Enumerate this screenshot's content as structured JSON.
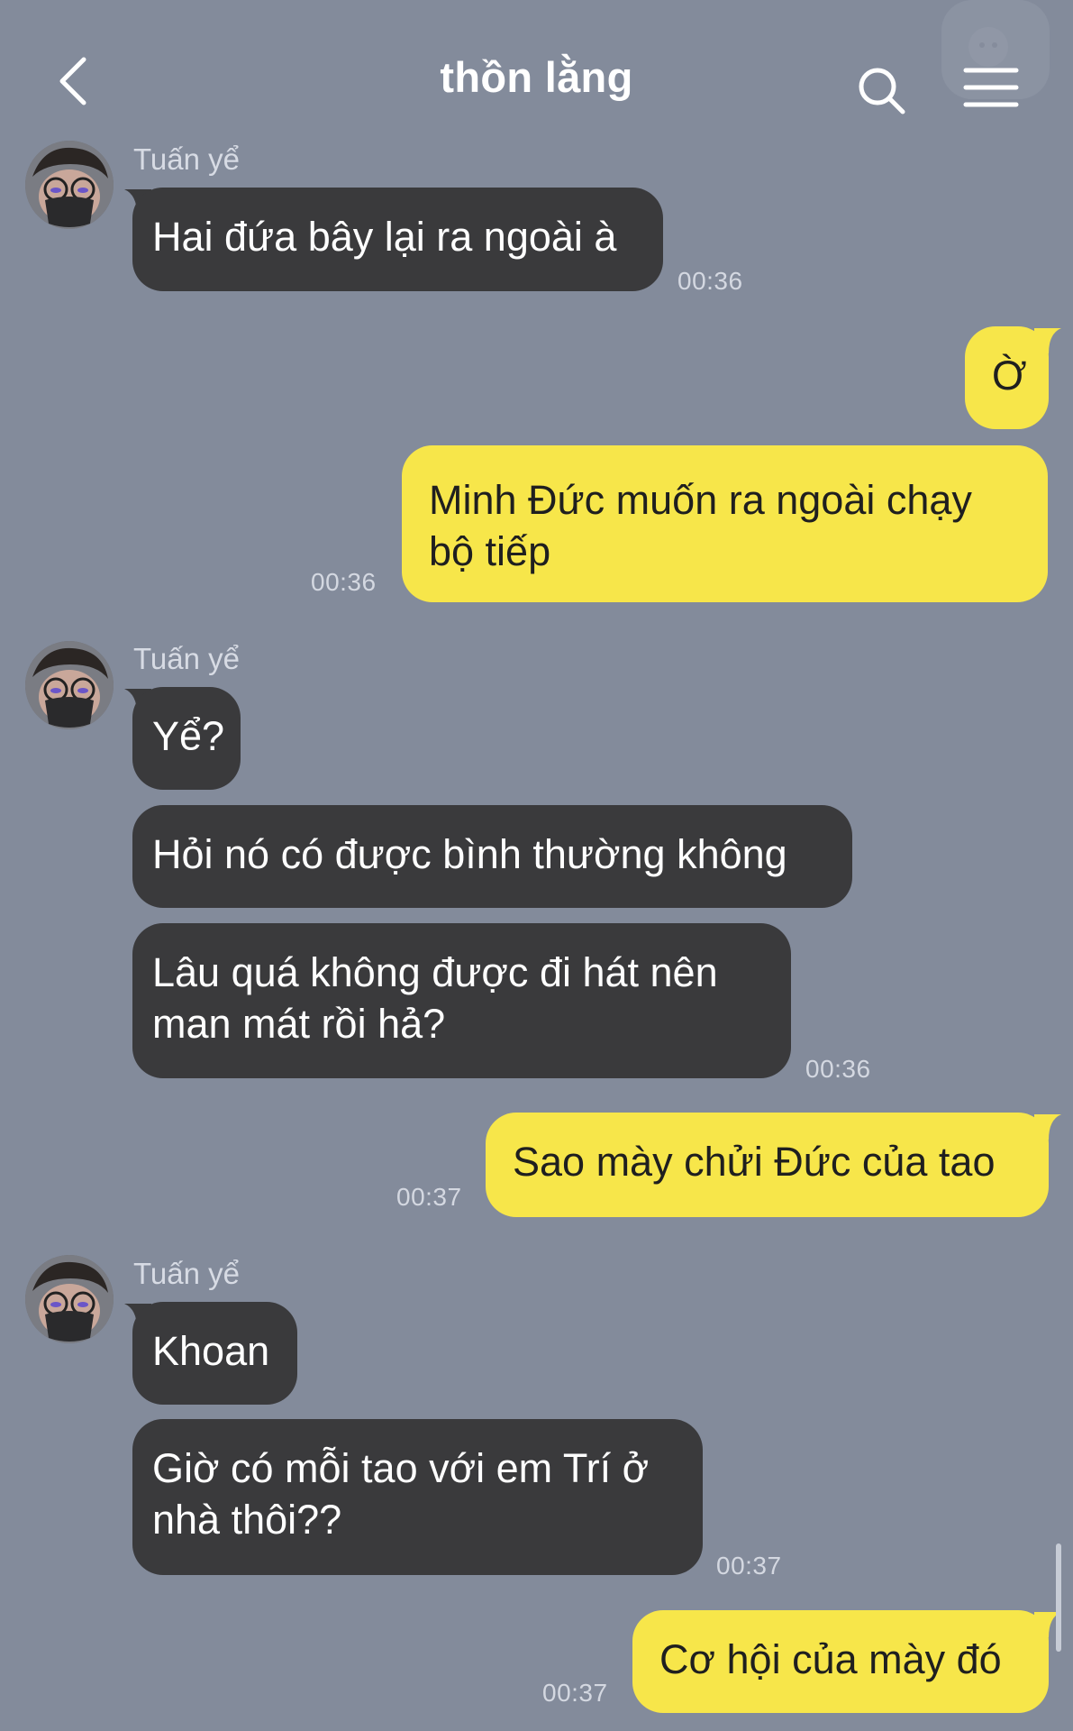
{
  "header": {
    "title": "thồn lằng",
    "back_icon": "chevron-left-icon",
    "search_icon": "search-icon",
    "menu_icon": "hamburger-menu-icon"
  },
  "colors": {
    "background": "#838b9b",
    "incoming_bubble": "#3a3a3c",
    "outgoing_bubble": "#f7e64a"
  },
  "messages": [
    {
      "sender": "Tuấn yể",
      "text": "Hai đứa bây lại ra ngoài à",
      "time": "00:36"
    },
    {
      "text": "Ờ"
    },
    {
      "text": "Minh Đức muốn ra ngoài chạy\nbộ tiếp",
      "time": "00:36"
    },
    {
      "sender": "Tuấn yể",
      "text": "Yể?"
    },
    {
      "text": "Hỏi nó có được bình thường không"
    },
    {
      "text": "Lâu quá không được đi hát nên\nman mát rồi hả?",
      "time": "00:36"
    },
    {
      "text": "Sao mày chửi Đức của tao",
      "time": "00:37"
    },
    {
      "sender": "Tuấn yể",
      "text": "Khoan"
    },
    {
      "text": "Giờ có mỗi tao với em Trí ở\nnhà thôi??",
      "time": "00:37"
    },
    {
      "text": "Cơ hội của mày đó",
      "time": "00:37"
    }
  ]
}
